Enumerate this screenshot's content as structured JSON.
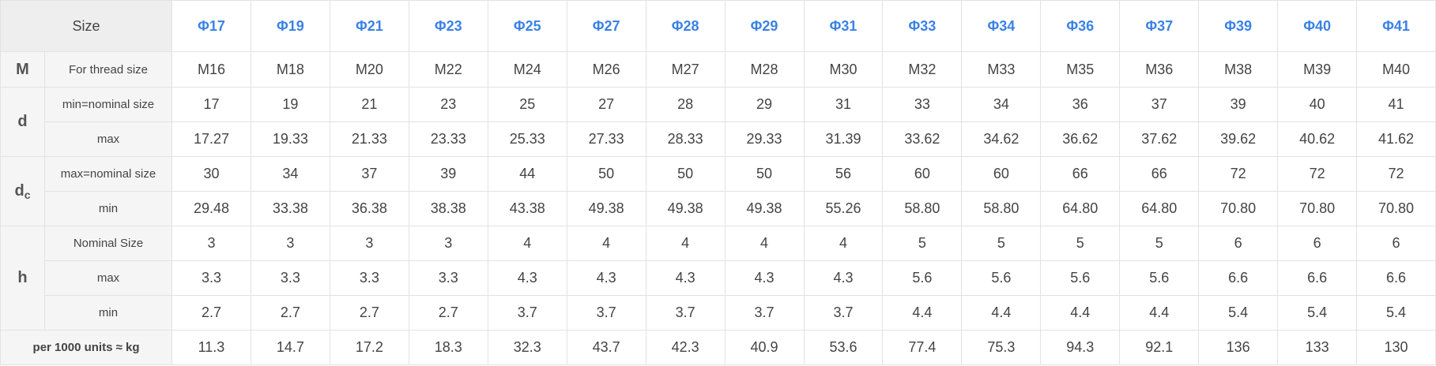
{
  "header": {
    "size_label": "Size",
    "sizes": [
      "Φ17",
      "Φ19",
      "Φ21",
      "Φ23",
      "Φ25",
      "Φ27",
      "Φ28",
      "Φ29",
      "Φ31",
      "Φ33",
      "Φ34",
      "Φ36",
      "Φ37",
      "Φ39",
      "Φ40",
      "Φ41"
    ]
  },
  "groups": [
    {
      "symbol": "M",
      "symbol_sub": "",
      "rows": [
        {
          "label": "For thread size",
          "values": [
            "M16",
            "M18",
            "M20",
            "M22",
            "M24",
            "M26",
            "M27",
            "M28",
            "M30",
            "M32",
            "M33",
            "M35",
            "M36",
            "M38",
            "M39",
            "M40"
          ]
        }
      ]
    },
    {
      "symbol": "d",
      "symbol_sub": "",
      "rows": [
        {
          "label": "min=nominal size",
          "values": [
            "17",
            "19",
            "21",
            "23",
            "25",
            "27",
            "28",
            "29",
            "31",
            "33",
            "34",
            "36",
            "37",
            "39",
            "40",
            "41"
          ]
        },
        {
          "label": "max",
          "values": [
            "17.27",
            "19.33",
            "21.33",
            "23.33",
            "25.33",
            "27.33",
            "28.33",
            "29.33",
            "31.39",
            "33.62",
            "34.62",
            "36.62",
            "37.62",
            "39.62",
            "40.62",
            "41.62"
          ]
        }
      ]
    },
    {
      "symbol": "d",
      "symbol_sub": "c",
      "rows": [
        {
          "label": "max=nominal size",
          "values": [
            "30",
            "34",
            "37",
            "39",
            "44",
            "50",
            "50",
            "50",
            "56",
            "60",
            "60",
            "66",
            "66",
            "72",
            "72",
            "72"
          ]
        },
        {
          "label": "min",
          "values": [
            "29.48",
            "33.38",
            "36.38",
            "38.38",
            "43.38",
            "49.38",
            "49.38",
            "49.38",
            "55.26",
            "58.80",
            "58.80",
            "64.80",
            "64.80",
            "70.80",
            "70.80",
            "70.80"
          ]
        }
      ]
    },
    {
      "symbol": "h",
      "symbol_sub": "",
      "rows": [
        {
          "label": "Nominal Size",
          "values": [
            "3",
            "3",
            "3",
            "3",
            "4",
            "4",
            "4",
            "4",
            "4",
            "5",
            "5",
            "5",
            "5",
            "6",
            "6",
            "6"
          ]
        },
        {
          "label": "max",
          "values": [
            "3.3",
            "3.3",
            "3.3",
            "3.3",
            "4.3",
            "4.3",
            "4.3",
            "4.3",
            "4.3",
            "5.6",
            "5.6",
            "5.6",
            "5.6",
            "6.6",
            "6.6",
            "6.6"
          ]
        },
        {
          "label": "min",
          "values": [
            "2.7",
            "2.7",
            "2.7",
            "2.7",
            "3.7",
            "3.7",
            "3.7",
            "3.7",
            "3.7",
            "4.4",
            "4.4",
            "4.4",
            "4.4",
            "5.4",
            "5.4",
            "5.4"
          ]
        }
      ]
    }
  ],
  "footer": {
    "label": "per 1000 units ≈ kg",
    "values": [
      "11.3",
      "14.7",
      "17.2",
      "18.3",
      "32.3",
      "43.7",
      "42.3",
      "40.9",
      "53.6",
      "77.4",
      "75.3",
      "94.3",
      "92.1",
      "136",
      "133",
      "130"
    ]
  }
}
